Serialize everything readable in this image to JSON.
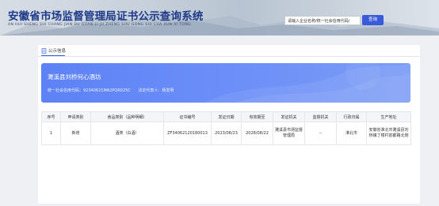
{
  "header": {
    "title": "安徽省市场监督管理局证书公示查询系统",
    "subtitle": "AN HUI SHENG SHI CHANG JIAN DU GUAN LI JU ZHENG SHU GONG SHI CHA XUN XI TONG",
    "search": {
      "value": "请输入企业名称/统一社会信用代码/",
      "button": "查询"
    }
  },
  "tab": {
    "label": "公示信息",
    "icon": "doc-icon"
  },
  "company": {
    "name": "濉溪县刘桥何心酒坊",
    "credit_code": "统一社会信用代码：92340621MA2PQR025C",
    "legal_rep": "法定代表人：杨发明"
  },
  "table": {
    "headers": [
      "序号",
      "申请类别",
      "食品类别（品种明细）",
      "证书编号",
      "发证日期",
      "有效期至",
      "发证机关",
      "监督机关",
      "行政归属",
      "生产地址"
    ],
    "rows": [
      [
        "1",
        "新增",
        "酒类（白酒）",
        "ZF34062120180013",
        "2023/08/23",
        "2028/08/22",
        "濉溪县市场监督管理局",
        "--",
        "淮北市",
        "安徽省淮北市濉溪县刘桥镇丁楼村前都路北侧"
      ]
    ]
  },
  "colors": {
    "brand": "#1f3a8a",
    "accent": "#3a5bd9",
    "banner": "#6b8ef8"
  }
}
